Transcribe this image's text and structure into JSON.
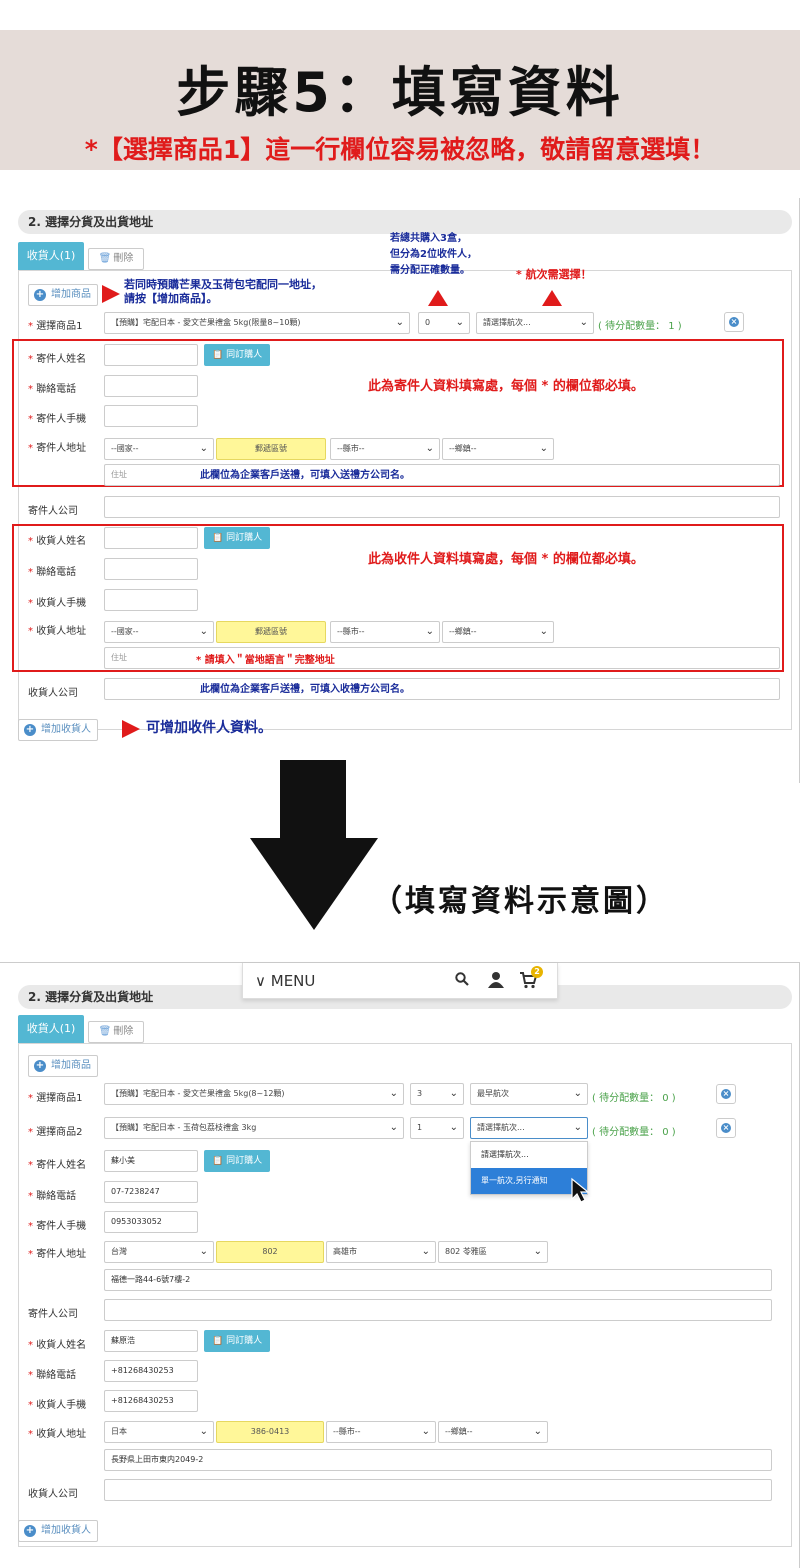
{
  "banner": {
    "title": "步驟5：填寫資料",
    "warning": "*【選擇商品1】這一行欄位容易被忽略，敬請留意選填！"
  },
  "section_title": "2. 選擇分貨及出貨地址",
  "tabs": {
    "recipient_tab": "收貨人(1)",
    "delete_tab": "刪除"
  },
  "buttons": {
    "add_product": "增加商品",
    "add_recipient": "增加收貨人",
    "same_as_buyer": "同訂購人"
  },
  "labels": {
    "product1": "選擇商品1",
    "product2": "選擇商品2",
    "sender_name": "寄件人姓名",
    "phone": "聯絡電話",
    "sender_mobile": "寄件人手機",
    "sender_address": "寄件人地址",
    "sender_company": "寄件人公司",
    "recipient_name": "收貨人姓名",
    "recipient_mobile": "收貨人手機",
    "recipient_address": "收貨人地址",
    "recipient_company": "收貨人公司",
    "required_mark": "*"
  },
  "placeholders": {
    "country": "--國家--",
    "zip": "郵遞區號",
    "county": "--縣市--",
    "district": "--鄉鎮--",
    "street": "住址",
    "flight": "請選擇航次..."
  },
  "panel1": {
    "product1_name": "【預購】宅配日本 - 愛文芒果禮盒 5kg(限量8~10顆)",
    "product1_qty": "0",
    "pending": "( 待分配數量： 1 )",
    "notes": {
      "add_product": [
        "若同時預購芒果及玉荷包宅配同一地址，",
        "請按【增加商品】。"
      ],
      "split": [
        "若總共購入3盒，",
        "但分為2位收件人，",
        "需分配正確數量。"
      ],
      "flight": "* 航次需選擇！",
      "sender_required": "此為寄件人資料填寫處，每個 * 的欄位都必填。",
      "sender_company": "此欄位為企業客戶送禮，可填入送禮方公司名。",
      "recipient_required": "此為收件人資料填寫處，每個 * 的欄位都必填。",
      "local_language": "* 請填入＂當地語言＂完整地址",
      "recipient_company": "此欄位為企業客戶送禮，可填入收禮方公司名。",
      "add_recipient": "可增加收件人資料。"
    }
  },
  "caption": "（填寫資料示意圖）",
  "panel2": {
    "menu_label": "MENU",
    "cart_count": "2",
    "product1_name": "【預購】宅配日本 - 愛文芒果禮盒 5kg(8~12顆)",
    "product1_qty": "3",
    "product1_flight": "最早航次",
    "product1_pending": "( 待分配數量： 0 )",
    "product2_name": "【預購】宅配日本 - 玉荷包荔枝禮盒 3kg",
    "product2_qty": "1",
    "product2_flight": "請選擇航次...",
    "product2_pending": "( 待分配數量： 0 )",
    "flight_options": [
      "請選擇航次...",
      "單一航次,另行通知"
    ],
    "sender_name": "蘇小美",
    "sender_phone": "07-7238247",
    "sender_mobile": "0953033052",
    "sender_country": "台灣",
    "sender_zip": "802",
    "sender_county": "高雄市",
    "sender_district": "802 苓雅區",
    "sender_street": "福德一路44-6號7樓-2",
    "recipient_name": "蘇原浩",
    "recipient_phone": "+81268430253",
    "recipient_mobile": "+81268430253",
    "recipient_country": "日本",
    "recipient_zip": "386-0413",
    "recipient_street": "長野県上田市東内2049-2"
  }
}
